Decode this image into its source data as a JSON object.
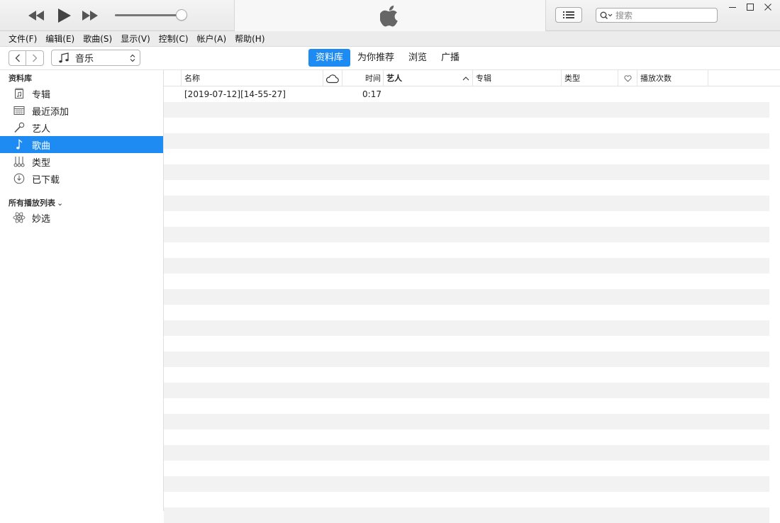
{
  "player": {
    "controls": {
      "prev": "rewind-icon",
      "play": "play-icon",
      "next": "fast-forward-icon"
    },
    "volume": 0.96,
    "logo": "apple-logo-icon"
  },
  "search": {
    "placeholder": "搜索"
  },
  "menu": [
    "文件(F)",
    "编辑(E)",
    "歌曲(S)",
    "显示(V)",
    "控制(C)",
    "帐户(A)",
    "帮助(H)"
  ],
  "nav": {
    "media_selector": "音乐",
    "tabs": [
      {
        "label": "资料库",
        "active": true
      },
      {
        "label": "为你推荐",
        "active": false
      },
      {
        "label": "浏览",
        "active": false
      },
      {
        "label": "广播",
        "active": false
      }
    ]
  },
  "sidebar": {
    "library_title": "资料库",
    "library": [
      {
        "label": "专辑",
        "icon": "album-icon"
      },
      {
        "label": "最近添加",
        "icon": "recently-added-icon"
      },
      {
        "label": "艺人",
        "icon": "microphone-icon"
      },
      {
        "label": "歌曲",
        "icon": "music-note-icon",
        "selected": true
      },
      {
        "label": "类型",
        "icon": "genres-icon"
      },
      {
        "label": "已下载",
        "icon": "downloaded-icon"
      }
    ],
    "playlists_title": "所有播放列表",
    "playlists": [
      {
        "label": "妙选",
        "icon": "genius-icon"
      }
    ]
  },
  "table": {
    "columns": {
      "name": "名称",
      "cloud": "cloud-icon",
      "time": "时间",
      "artist": "艺人",
      "album": "专辑",
      "genre": "类型",
      "love": "heart-icon",
      "plays": "播放次数"
    },
    "sort_column": "artist",
    "sort_direction": "ascending",
    "rows": [
      {
        "name": "[2019-07-12][14-55-27]",
        "time": "0:17",
        "artist": "",
        "album": "",
        "genre": "",
        "plays": ""
      }
    ]
  },
  "colors": {
    "accent": "#1d8bf1",
    "stripe": "#f2f2f2"
  }
}
